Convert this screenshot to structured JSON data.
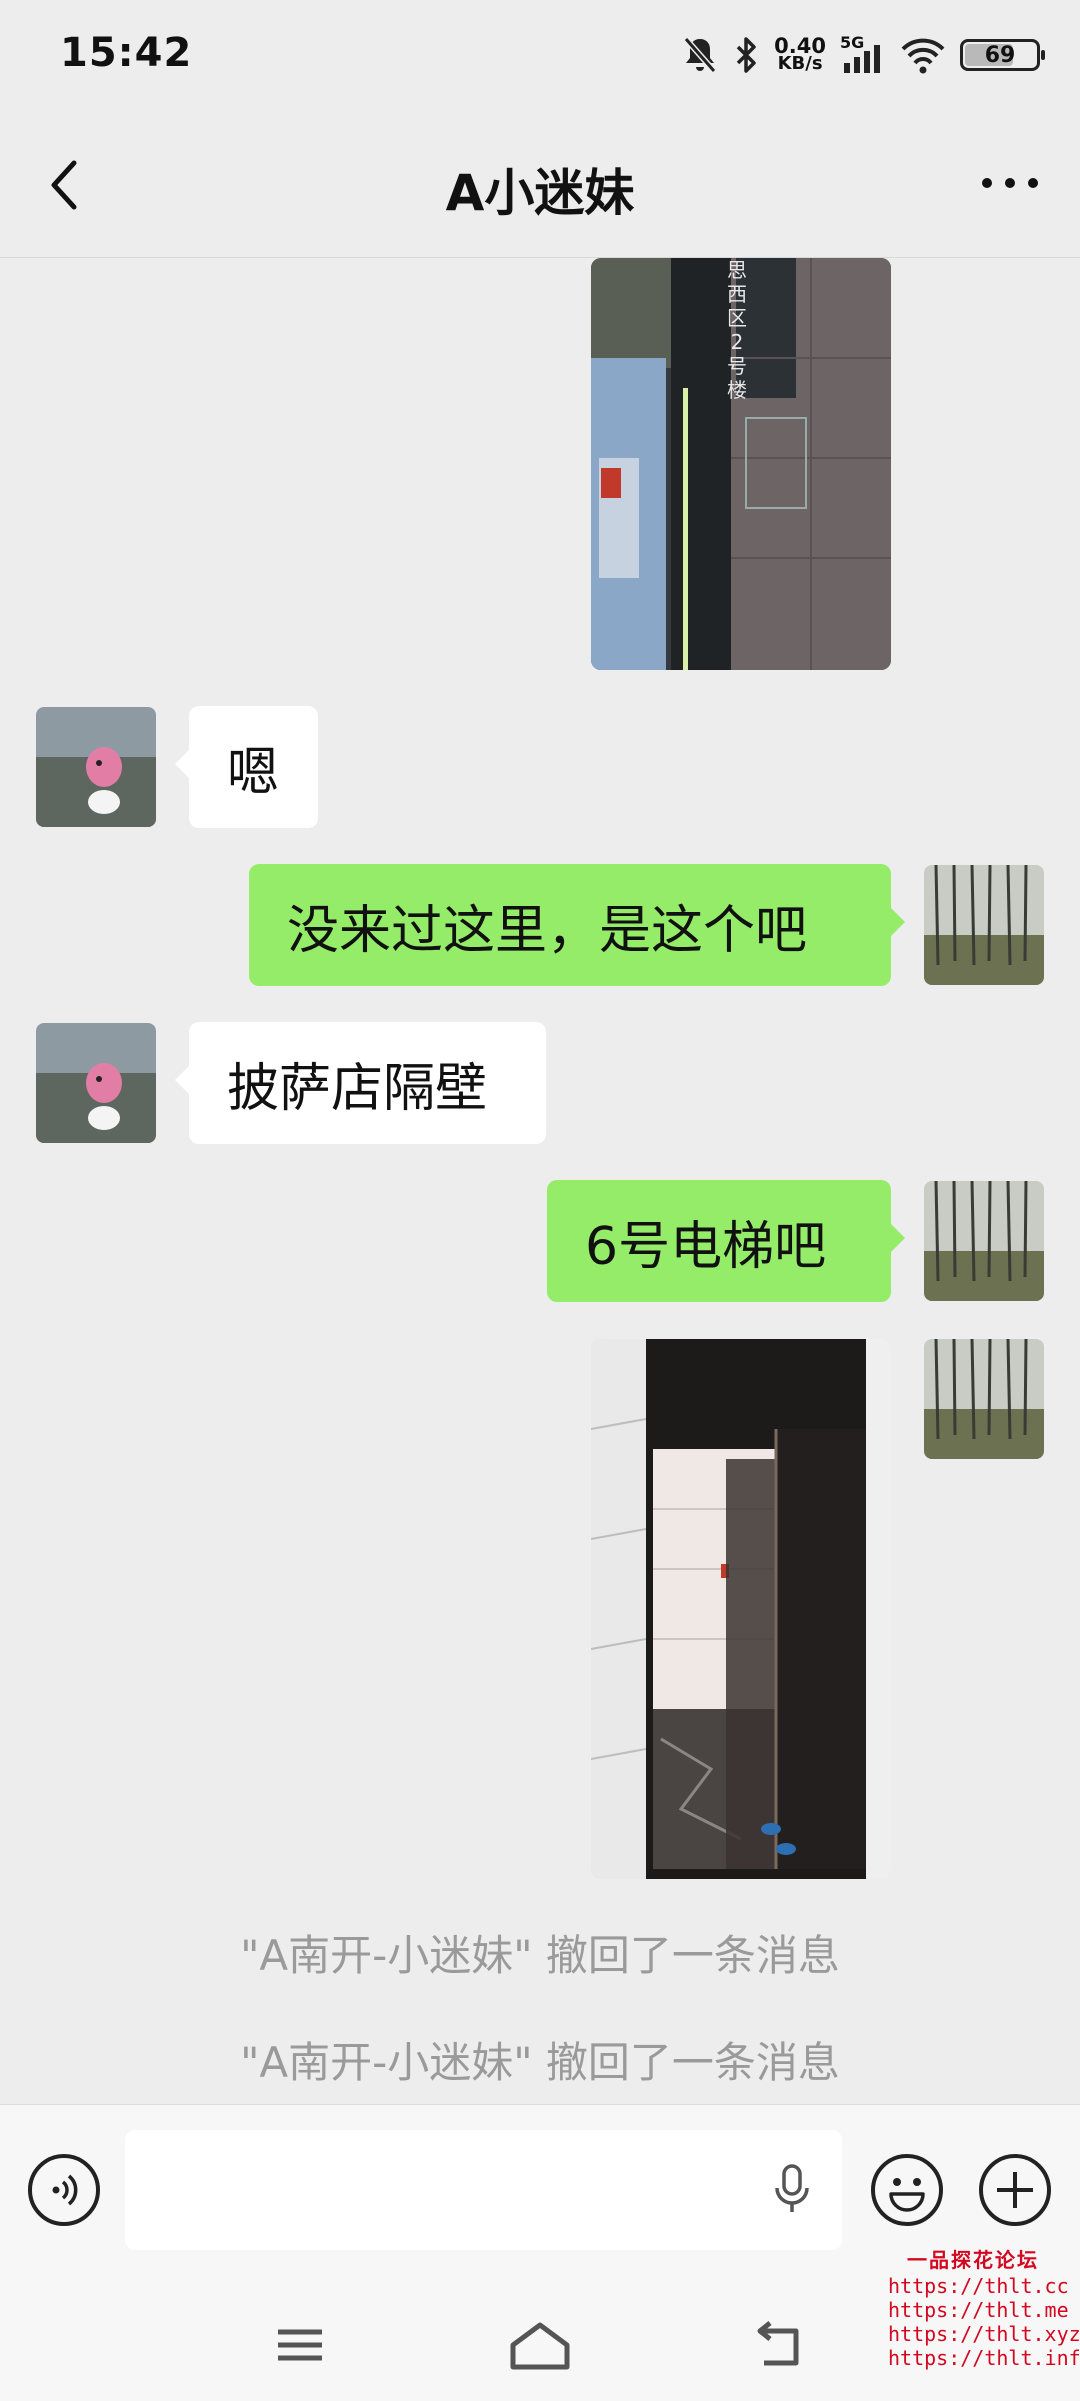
{
  "status_bar": {
    "time": "15:42",
    "net_speed_value": "0.40",
    "net_speed_unit": "KB/s",
    "network_type": "5G",
    "battery_level": "69"
  },
  "header": {
    "title": "A小迷妹",
    "back_icon": "chevron-left-icon",
    "more_icon": "more-horizontal-icon"
  },
  "messages": {
    "m1": "嗯",
    "m2": "没来过这里，是这个吧",
    "m3": "披萨店隔壁",
    "m4": "6号电梯吧",
    "recall_1": "\"A南开-小迷妹\" 撤回了一条消息",
    "recall_2": "\"A南开-小迷妹\" 撤回了一条消息"
  },
  "photo_text": {
    "sign": "思西区2号楼"
  },
  "input": {
    "placeholder": "",
    "voice_icon": "voice-icon",
    "mic_icon": "mic-icon",
    "emoji_icon": "emoji-icon",
    "plus_icon": "plus-icon"
  },
  "watermark": {
    "logo_text": "一品探花论坛",
    "urls": [
      "https://thlt.cc",
      "https://thlt.me",
      "https://thlt.xyz",
      "https://thlt.info"
    ]
  },
  "colors": {
    "background": "#ededed",
    "my_bubble": "#95ec69",
    "their_bubble": "#ffffff",
    "watermark": "#d3071f"
  }
}
